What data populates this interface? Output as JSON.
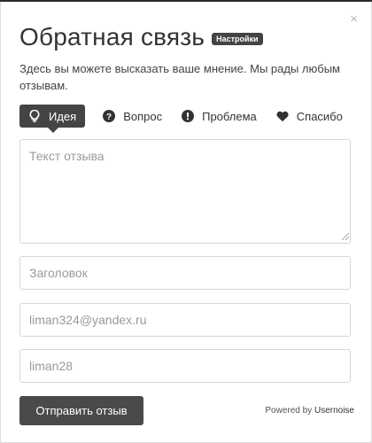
{
  "dialog": {
    "close_glyph": "×",
    "title": "Обратная связь",
    "settings_badge": "Настройки",
    "description": "Здесь вы можете высказать ваше мнение. Мы рады любым отзывам."
  },
  "tabs": [
    {
      "label": "Идея",
      "icon": "lightbulb-icon",
      "active": true
    },
    {
      "label": "Вопрос",
      "icon": "question-circle-icon",
      "active": false
    },
    {
      "label": "Проблема",
      "icon": "exclamation-circle-icon",
      "active": false
    },
    {
      "label": "Спасибо",
      "icon": "heart-icon",
      "active": false
    }
  ],
  "form": {
    "feedback_placeholder": "Текст отзыва",
    "subject_placeholder": "Заголовок",
    "email_value": "liman324@yandex.ru",
    "name_value": "liman28",
    "submit_label": "Отправить отзыв"
  },
  "footer": {
    "powered_by": "Powered by",
    "brand": "Usernoise"
  },
  "colors": {
    "accent_dark": "#444444",
    "button_bg": "#4a4a4a",
    "border": "#d6d6d6"
  }
}
